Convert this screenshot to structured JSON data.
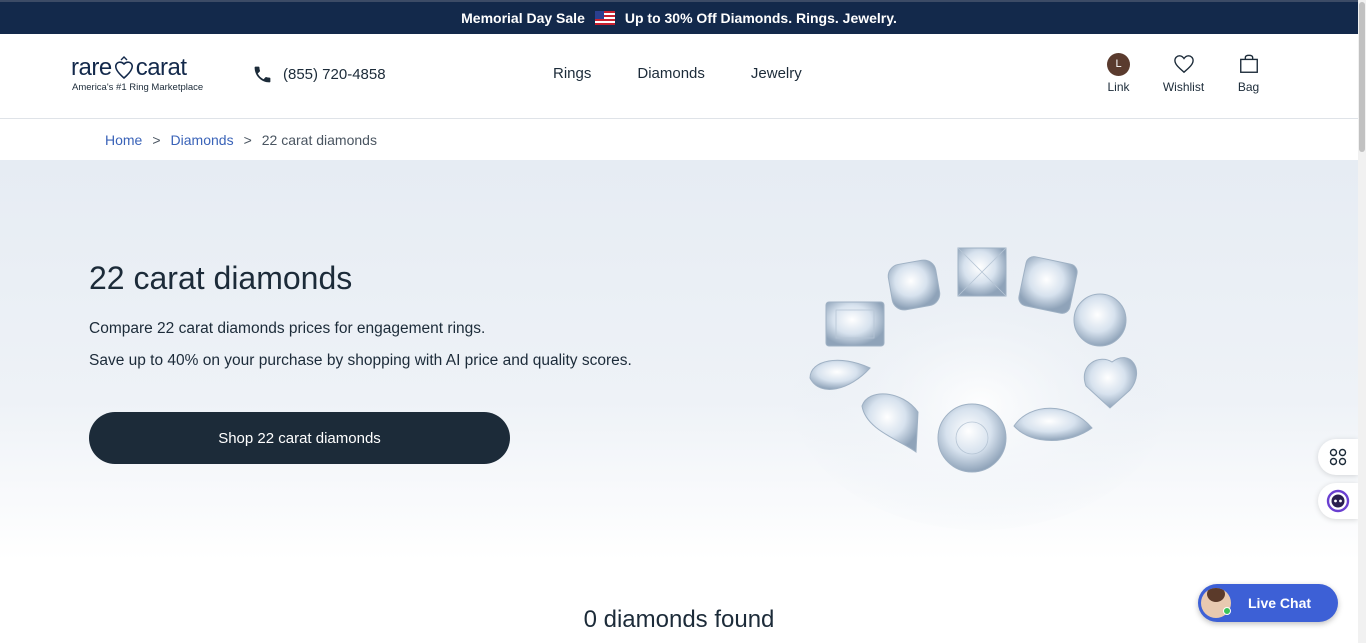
{
  "promo": {
    "sale": "Memorial Day Sale",
    "offer": "Up to 30% Off Diamonds. Rings. Jewelry."
  },
  "header": {
    "logo_left": "rare",
    "logo_right": "carat",
    "logo_tagline": "America's #1 Ring Marketplace",
    "phone": "(855) 720-4858",
    "nav": [
      "Rings",
      "Diamonds",
      "Jewelry"
    ],
    "account_initial": "L",
    "account_label": "Link",
    "wishlist_label": "Wishlist",
    "bag_label": "Bag"
  },
  "breadcrumb": {
    "home": "Home",
    "diamonds": "Diamonds",
    "current": "22 carat diamonds",
    "separator": ">"
  },
  "hero": {
    "title": "22 carat diamonds",
    "line1": "Compare 22 carat diamonds prices for engagement rings.",
    "line2": "Save up to 40% on your purchase by shopping with AI price and quality scores.",
    "cta": "Shop 22 carat diamonds"
  },
  "results": {
    "found": "0 diamonds found"
  },
  "livechat": {
    "label": "Live Chat"
  },
  "colors": {
    "navy": "#13294b",
    "dark": "#1c2b39",
    "link": "#3a63b8",
    "chat": "#3d60d6"
  }
}
